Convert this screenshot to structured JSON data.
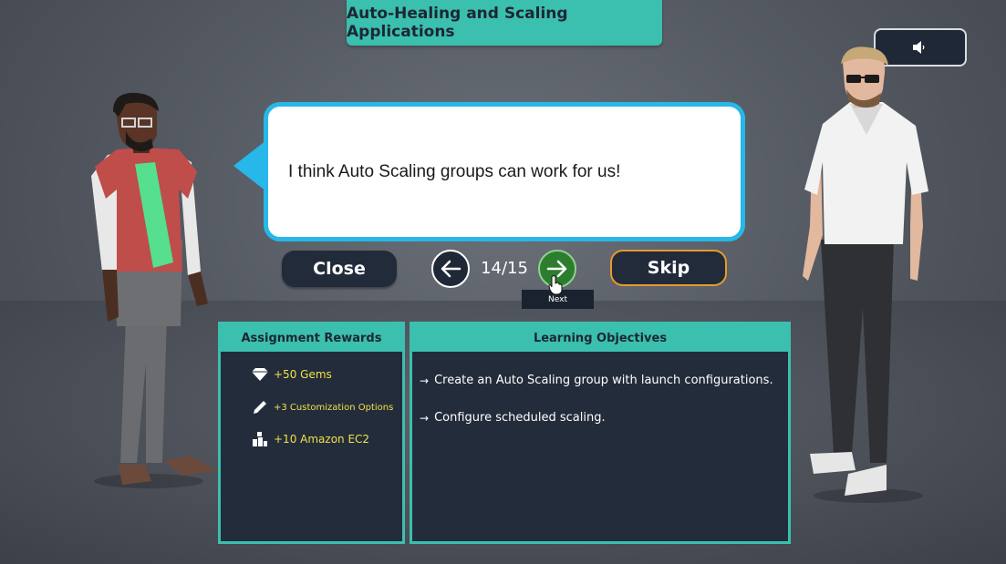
{
  "title": "Auto-Healing and Scaling Applications",
  "dialog": {
    "text": "I think Auto Scaling groups can work for us!"
  },
  "navigation": {
    "close_label": "Close",
    "skip_label": "Skip",
    "counter": "14/15",
    "next_tooltip": "Next"
  },
  "rewards": {
    "header": "Assignment Rewards",
    "items": [
      {
        "icon": "gem-icon",
        "text": "+50 Gems"
      },
      {
        "icon": "pencil-icon",
        "text": "+3 Customization Options"
      },
      {
        "icon": "ec2-icon",
        "text": "+10 Amazon EC2"
      }
    ]
  },
  "objectives": {
    "header": "Learning Objectives",
    "items": [
      "Create an Auto Scaling group with launch configurations.",
      "Configure scheduled scaling."
    ]
  },
  "colors": {
    "accent": "#3bbfae",
    "bubble_border": "#27b7e8",
    "skip_border": "#e79a2d",
    "next_button": "#2d7d2e",
    "reward_text": "#f2e04a",
    "panel_bg": "#232c3b"
  }
}
